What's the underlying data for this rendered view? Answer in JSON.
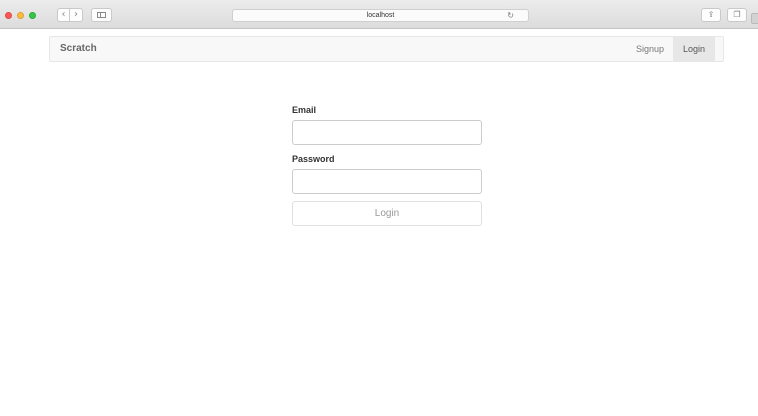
{
  "browser": {
    "address": "localhost",
    "icons": {
      "back": "chevron-left-icon",
      "forward": "chevron-right-icon",
      "sidebar": "sidebar-icon",
      "reload": "reload-icon",
      "share": "share-icon",
      "tabs": "tabs-icon"
    },
    "glyphs": {
      "back": "‹",
      "forward": "›",
      "reload": "↻",
      "share": "⇪",
      "tabs": "❐"
    }
  },
  "navbar": {
    "brand": "Scratch",
    "links": {
      "signup": "Signup",
      "login": "Login"
    },
    "active_link": "login"
  },
  "form": {
    "email_label": "Email",
    "email_value": "",
    "password_label": "Password",
    "password_value": "",
    "submit_label": "Login"
  },
  "colors": {
    "navbar_bg": "#f8f8f8",
    "active_link_bg": "#e7e7e7",
    "close_light": "#fc5753",
    "minimize_light": "#fdbc40",
    "zoom_light": "#33c748"
  }
}
